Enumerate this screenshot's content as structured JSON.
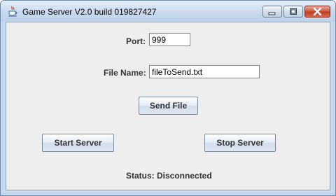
{
  "window": {
    "title": "Game Server V2.0 build 019827427",
    "app_icon": "java-cup-icon",
    "controls": {
      "minimize_icon": "minimize-icon",
      "maximize_icon": "maximize-icon",
      "close_icon": "close-icon"
    }
  },
  "form": {
    "port_label": "Port:",
    "port_value": "999",
    "filename_label": "File Name:",
    "filename_value": "fileToSend.txt",
    "send_file_label": "Send File",
    "start_server_label": "Start Server",
    "stop_server_label": "Stop Server",
    "status_text": "Status: Disconnected"
  },
  "colors": {
    "titlebar": "#c9daee",
    "panel": "#eeeeee",
    "close_button": "#c13a21",
    "label_text": "#333333"
  }
}
